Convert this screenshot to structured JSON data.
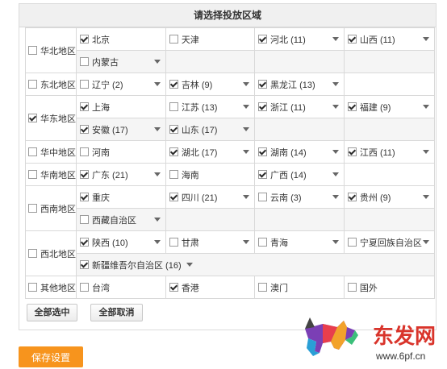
{
  "title": "请选择投放区域",
  "regions": [
    {
      "label": "华北地区",
      "checked": false,
      "rows": [
        [
          {
            "label": "北京",
            "checked": true,
            "dropdown": false
          },
          {
            "label": "天津",
            "checked": false,
            "dropdown": false
          },
          {
            "label": "河北 (11)",
            "checked": true,
            "dropdown": true
          },
          {
            "label": "山西 (11)",
            "checked": true,
            "dropdown": true
          }
        ],
        [
          {
            "label": "内蒙古",
            "checked": false,
            "dropdown": true
          }
        ]
      ]
    },
    {
      "label": "东北地区",
      "checked": false,
      "rows": [
        [
          {
            "label": "辽宁 (2)",
            "checked": false,
            "dropdown": true
          },
          {
            "label": "吉林 (9)",
            "checked": true,
            "dropdown": true
          },
          {
            "label": "黑龙江 (13)",
            "checked": true,
            "dropdown": true
          }
        ]
      ]
    },
    {
      "label": "华东地区",
      "checked": true,
      "rows": [
        [
          {
            "label": "上海",
            "checked": true,
            "dropdown": false
          },
          {
            "label": "江苏 (13)",
            "checked": false,
            "dropdown": true
          },
          {
            "label": "浙江 (11)",
            "checked": true,
            "dropdown": true
          },
          {
            "label": "福建 (9)",
            "checked": true,
            "dropdown": true
          }
        ],
        [
          {
            "label": "安徽 (17)",
            "checked": true,
            "dropdown": true
          },
          {
            "label": "山东 (17)",
            "checked": true,
            "dropdown": true
          }
        ]
      ]
    },
    {
      "label": "华中地区",
      "checked": false,
      "rows": [
        [
          {
            "label": "河南",
            "checked": false,
            "dropdown": false
          },
          {
            "label": "湖北 (17)",
            "checked": true,
            "dropdown": true
          },
          {
            "label": "湖南 (14)",
            "checked": true,
            "dropdown": true
          },
          {
            "label": "江西 (11)",
            "checked": true,
            "dropdown": true
          }
        ]
      ]
    },
    {
      "label": "华南地区",
      "checked": false,
      "rows": [
        [
          {
            "label": "广东 (21)",
            "checked": true,
            "dropdown": true
          },
          {
            "label": "海南",
            "checked": false,
            "dropdown": false
          },
          {
            "label": "广西 (14)",
            "checked": true,
            "dropdown": true
          }
        ]
      ]
    },
    {
      "label": "西南地区",
      "checked": false,
      "rows": [
        [
          {
            "label": "重庆",
            "checked": true,
            "dropdown": false
          },
          {
            "label": "四川 (21)",
            "checked": true,
            "dropdown": true
          },
          {
            "label": "云南 (3)",
            "checked": false,
            "dropdown": true
          },
          {
            "label": "贵州 (9)",
            "checked": true,
            "dropdown": true
          }
        ],
        [
          {
            "label": "西藏自治区",
            "checked": false,
            "dropdown": true
          }
        ]
      ]
    },
    {
      "label": "西北地区",
      "checked": false,
      "rows": [
        [
          {
            "label": "陕西 (10)",
            "checked": true,
            "dropdown": true
          },
          {
            "label": "甘肃",
            "checked": false,
            "dropdown": true
          },
          {
            "label": "青海",
            "checked": false,
            "dropdown": true
          },
          {
            "label": "宁夏回族自治区",
            "checked": false,
            "dropdown": true
          }
        ],
        [
          {
            "label": "新疆维吾尔自治区 (16)",
            "checked": true,
            "dropdown": true,
            "inline": true
          }
        ]
      ]
    },
    {
      "label": "其他地区",
      "checked": false,
      "rows": [
        [
          {
            "label": "台湾",
            "checked": false,
            "dropdown": false
          },
          {
            "label": "香港",
            "checked": true,
            "dropdown": false
          },
          {
            "label": "澳门",
            "checked": false,
            "dropdown": false
          },
          {
            "label": "国外",
            "checked": false,
            "dropdown": false
          }
        ]
      ]
    }
  ],
  "buttons": {
    "select_all": "全部选中",
    "deselect_all": "全部取消",
    "save": "保存设置"
  },
  "watermark": {
    "brand": "东发网",
    "url": "www.6pf.cn"
  },
  "colors": {
    "accent": "#f7941d",
    "header_bg": "#f0f0f0",
    "row_alt": "#f5f5f5"
  }
}
